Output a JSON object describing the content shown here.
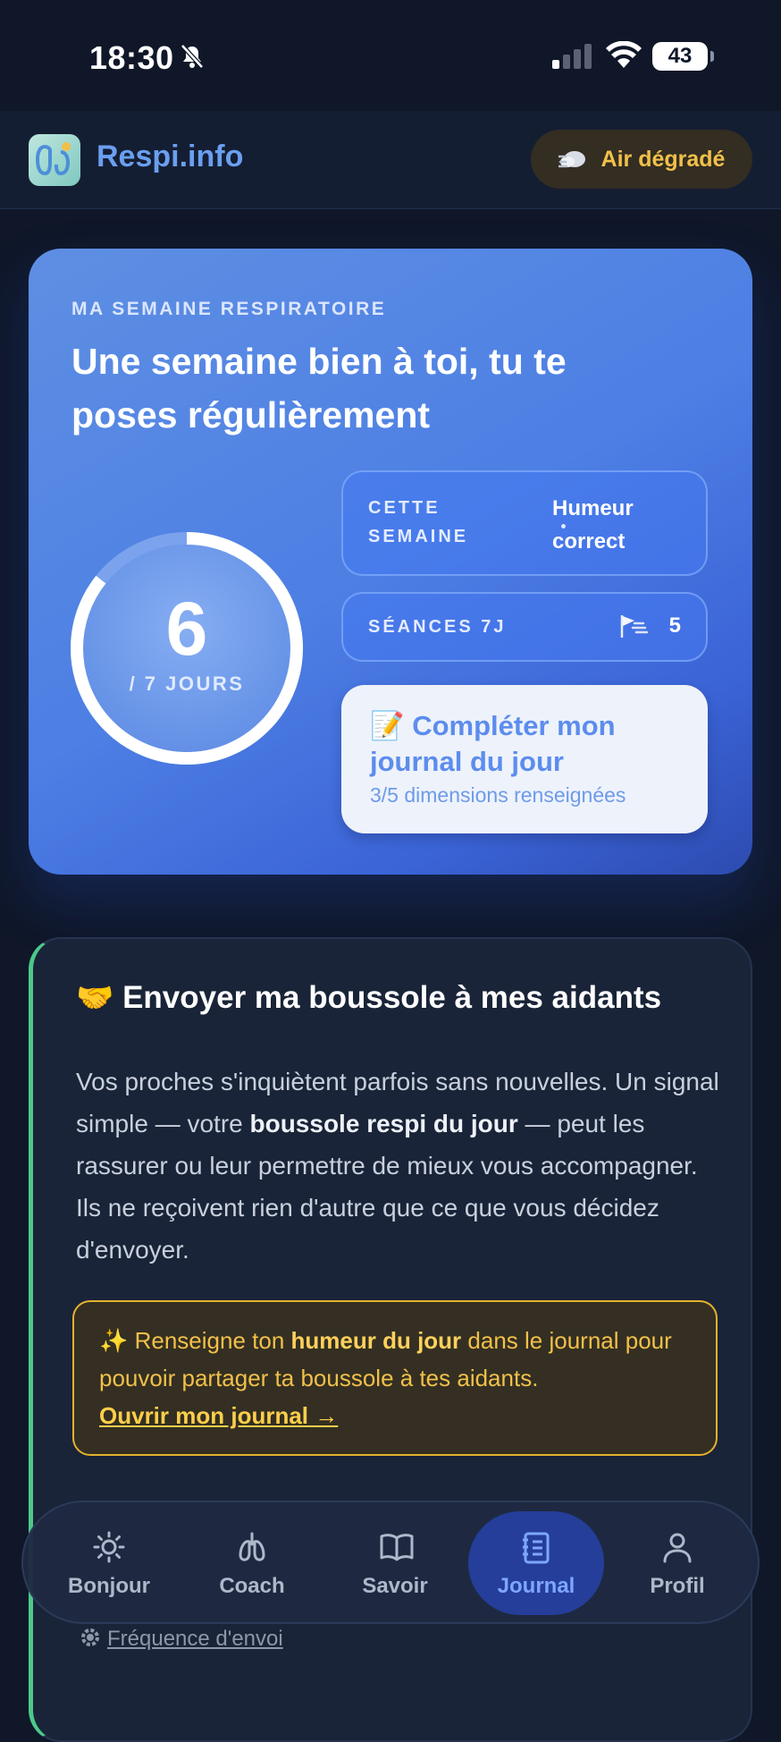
{
  "status_bar": {
    "time": "18:30",
    "battery": "43"
  },
  "header": {
    "brand": "Respi.info",
    "air_badge": "Air dégradé"
  },
  "hero": {
    "eyebrow": "MA SEMAINE RESPIRATOIRE",
    "headline": "Une semaine bien à toi, tu te poses régulièrement",
    "ring": {
      "value": "6",
      "suffix": "/ 7 JOURS",
      "fraction": 0.857
    },
    "week_label": "CETTE SEMAINE",
    "week_value": "Humeur correct",
    "sessions_label": "SÉANCES 7J",
    "sessions_value": "5",
    "journal_cta": "📝 Compléter mon journal du jour",
    "journal_sub": "3/5 dimensions renseignées"
  },
  "share": {
    "title": "Envoyer ma boussole à mes aidants",
    "title_emoji": "🤝",
    "body_1": "Vos proches s'inquiètent parfois sans nouvelles. Un signal simple — votre ",
    "body_bold": "boussole respi du jour",
    "body_2": " — peut les rassurer ou leur permettre de mieux vous accompagner. Ils ne reçoivent rien d'autre que ce que vous décidez d'envoyer.",
    "notice_emoji": "✨",
    "notice_1": " Renseigne ton ",
    "notice_bold": "humeur du jour",
    "notice_2": " dans le journal pour pouvoir partager ta boussole à tes aidants.",
    "notice_link": "Ouvrir mon journal →",
    "frequency_link": "Fréquence d'envoi"
  },
  "nav": {
    "items": [
      {
        "label": "Bonjour",
        "icon": "sun-icon"
      },
      {
        "label": "Coach",
        "icon": "lungs-icon"
      },
      {
        "label": "Savoir",
        "icon": "book-icon"
      },
      {
        "label": "Journal",
        "icon": "notebook-icon"
      },
      {
        "label": "Profil",
        "icon": "user-icon"
      }
    ],
    "active": "Journal"
  },
  "colors": {
    "accent": "#4d7fe4",
    "warning": "#f2c04a",
    "success": "#4cc98b",
    "background": "#0f1729"
  }
}
